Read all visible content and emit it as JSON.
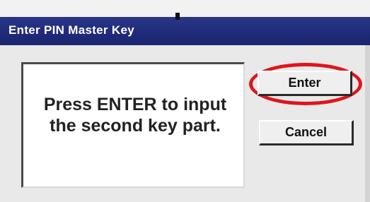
{
  "dialog": {
    "title": "Enter PIN Master Key",
    "message": "Press ENTER to input the second key part.",
    "buttons": {
      "enter_label": "Enter",
      "cancel_label": "Cancel"
    }
  },
  "colors": {
    "titlebar": "#1f2a78",
    "highlight": "#e0151b",
    "window_bg": "#e9e9e9"
  }
}
